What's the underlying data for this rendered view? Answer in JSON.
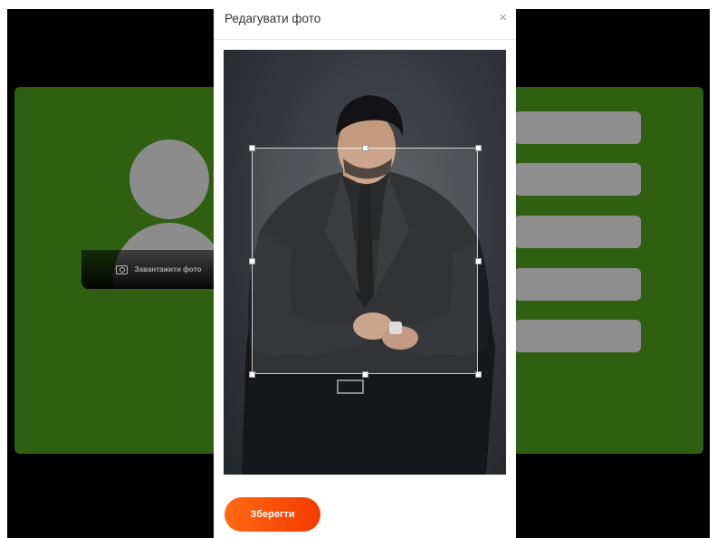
{
  "modal": {
    "title": "Редагувати фото",
    "close_symbol": "×",
    "save_label": "Зберегти",
    "accent_color": "#ff5a0d"
  },
  "background": {
    "upload_label": "Завантажити фото",
    "card_color": "#2f5f10",
    "field_count": 5
  },
  "icons": [
    "close-icon",
    "camera-icon",
    "avatar-placeholder"
  ]
}
